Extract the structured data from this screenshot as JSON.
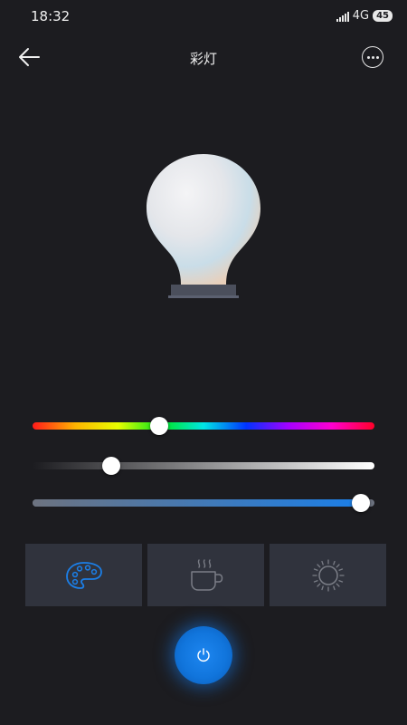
{
  "status_bar": {
    "time": "18:32",
    "network": "4G",
    "battery": "45"
  },
  "header": {
    "title": "彩灯",
    "back_icon": "arrow-left-icon",
    "more_icon": "more-circle-icon"
  },
  "sliders": {
    "hue": {
      "value_percent": 37
    },
    "saturation": {
      "value_percent": 23
    },
    "brightness": {
      "value_percent": 96,
      "accent": "#1b7fe8"
    }
  },
  "modes": [
    {
      "icon": "palette-icon",
      "active": true,
      "color": "#1b7fe8"
    },
    {
      "icon": "coffee-cup-icon",
      "active": false,
      "color": "#7a7d86"
    },
    {
      "icon": "sun-icon",
      "active": false,
      "color": "#7a7d86"
    }
  ],
  "power": {
    "icon": "power-icon",
    "color": "#1b7fe8"
  }
}
